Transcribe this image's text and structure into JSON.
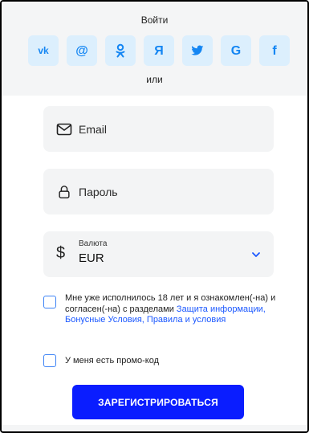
{
  "header": {
    "title": "Войти",
    "or_text": "или"
  },
  "social": [
    {
      "name": "vk",
      "glyph": "vk"
    },
    {
      "name": "mail",
      "glyph": "@"
    },
    {
      "name": "ok",
      "glyph": "ok"
    },
    {
      "name": "yandex",
      "glyph": "Я"
    },
    {
      "name": "twitter",
      "glyph": "tw"
    },
    {
      "name": "google",
      "glyph": "G"
    },
    {
      "name": "facebook",
      "glyph": "f"
    }
  ],
  "form": {
    "email_placeholder": "Email",
    "password_placeholder": "Пароль",
    "currency_label": "Валюта",
    "currency_value": "EUR",
    "currency_symbol": "$",
    "terms_text": "Мне уже исполнилось 18 лет и я ознакомлен(-на) и согласен(-на) с разделами ",
    "terms_links": "Защита информации, Бонусные Условия, Правила и условия",
    "promo_text": "У меня есть промо-код",
    "submit_label": "ЗАРЕГИСТРИРОВАТЬСЯ"
  },
  "colors": {
    "accent": "#0a1dff",
    "social_bg": "#dceffd",
    "social_icon": "#1486f3",
    "field_bg": "#f3f4f5",
    "link": "#1a57ff"
  }
}
